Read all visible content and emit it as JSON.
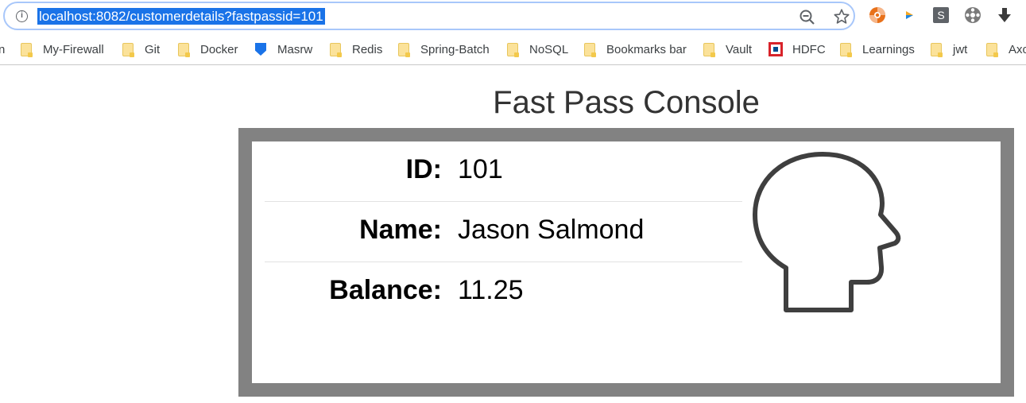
{
  "browser": {
    "url": "localhost:8082/customerdetails?fastpassid=101",
    "info_icon": "info-icon",
    "zoom_icon": "zoom-icon",
    "star_icon": "star-icon",
    "extensions": [
      "lifebuoy-icon",
      "play-icon",
      "s-extension-icon",
      "film-reel-icon",
      "download-arrow-icon"
    ]
  },
  "bookmarks": {
    "partial_first": "n",
    "items": [
      {
        "label": "My-Firewall",
        "icon": "folder-icon"
      },
      {
        "label": "Git",
        "icon": "folder-icon"
      },
      {
        "label": "Docker",
        "icon": "folder-icon"
      },
      {
        "label": "Masrw",
        "icon": "shield-icon"
      },
      {
        "label": "Redis",
        "icon": "folder-icon"
      },
      {
        "label": "Spring-Batch",
        "icon": "folder-icon"
      },
      {
        "label": "NoSQL",
        "icon": "folder-icon"
      },
      {
        "label": "Bookmarks bar",
        "icon": "folder-icon"
      },
      {
        "label": "Vault",
        "icon": "folder-icon"
      },
      {
        "label": "HDFC",
        "icon": "hdfc-logo-icon"
      },
      {
        "label": "Learnings",
        "icon": "folder-icon"
      },
      {
        "label": "jwt",
        "icon": "folder-icon"
      },
      {
        "label": "Axo",
        "icon": "folder-icon"
      }
    ]
  },
  "page": {
    "title": "Fast Pass Console",
    "customer": {
      "id_label": "ID:",
      "id_value": "101",
      "name_label": "Name:",
      "name_value": "Jason Salmond",
      "balance_label": "Balance:",
      "balance_value": "11.25"
    },
    "avatar_icon": "head-profile-icon"
  },
  "colors": {
    "url_highlight": "#1a73e8",
    "card_border": "#828282",
    "title_text": "#333333"
  }
}
